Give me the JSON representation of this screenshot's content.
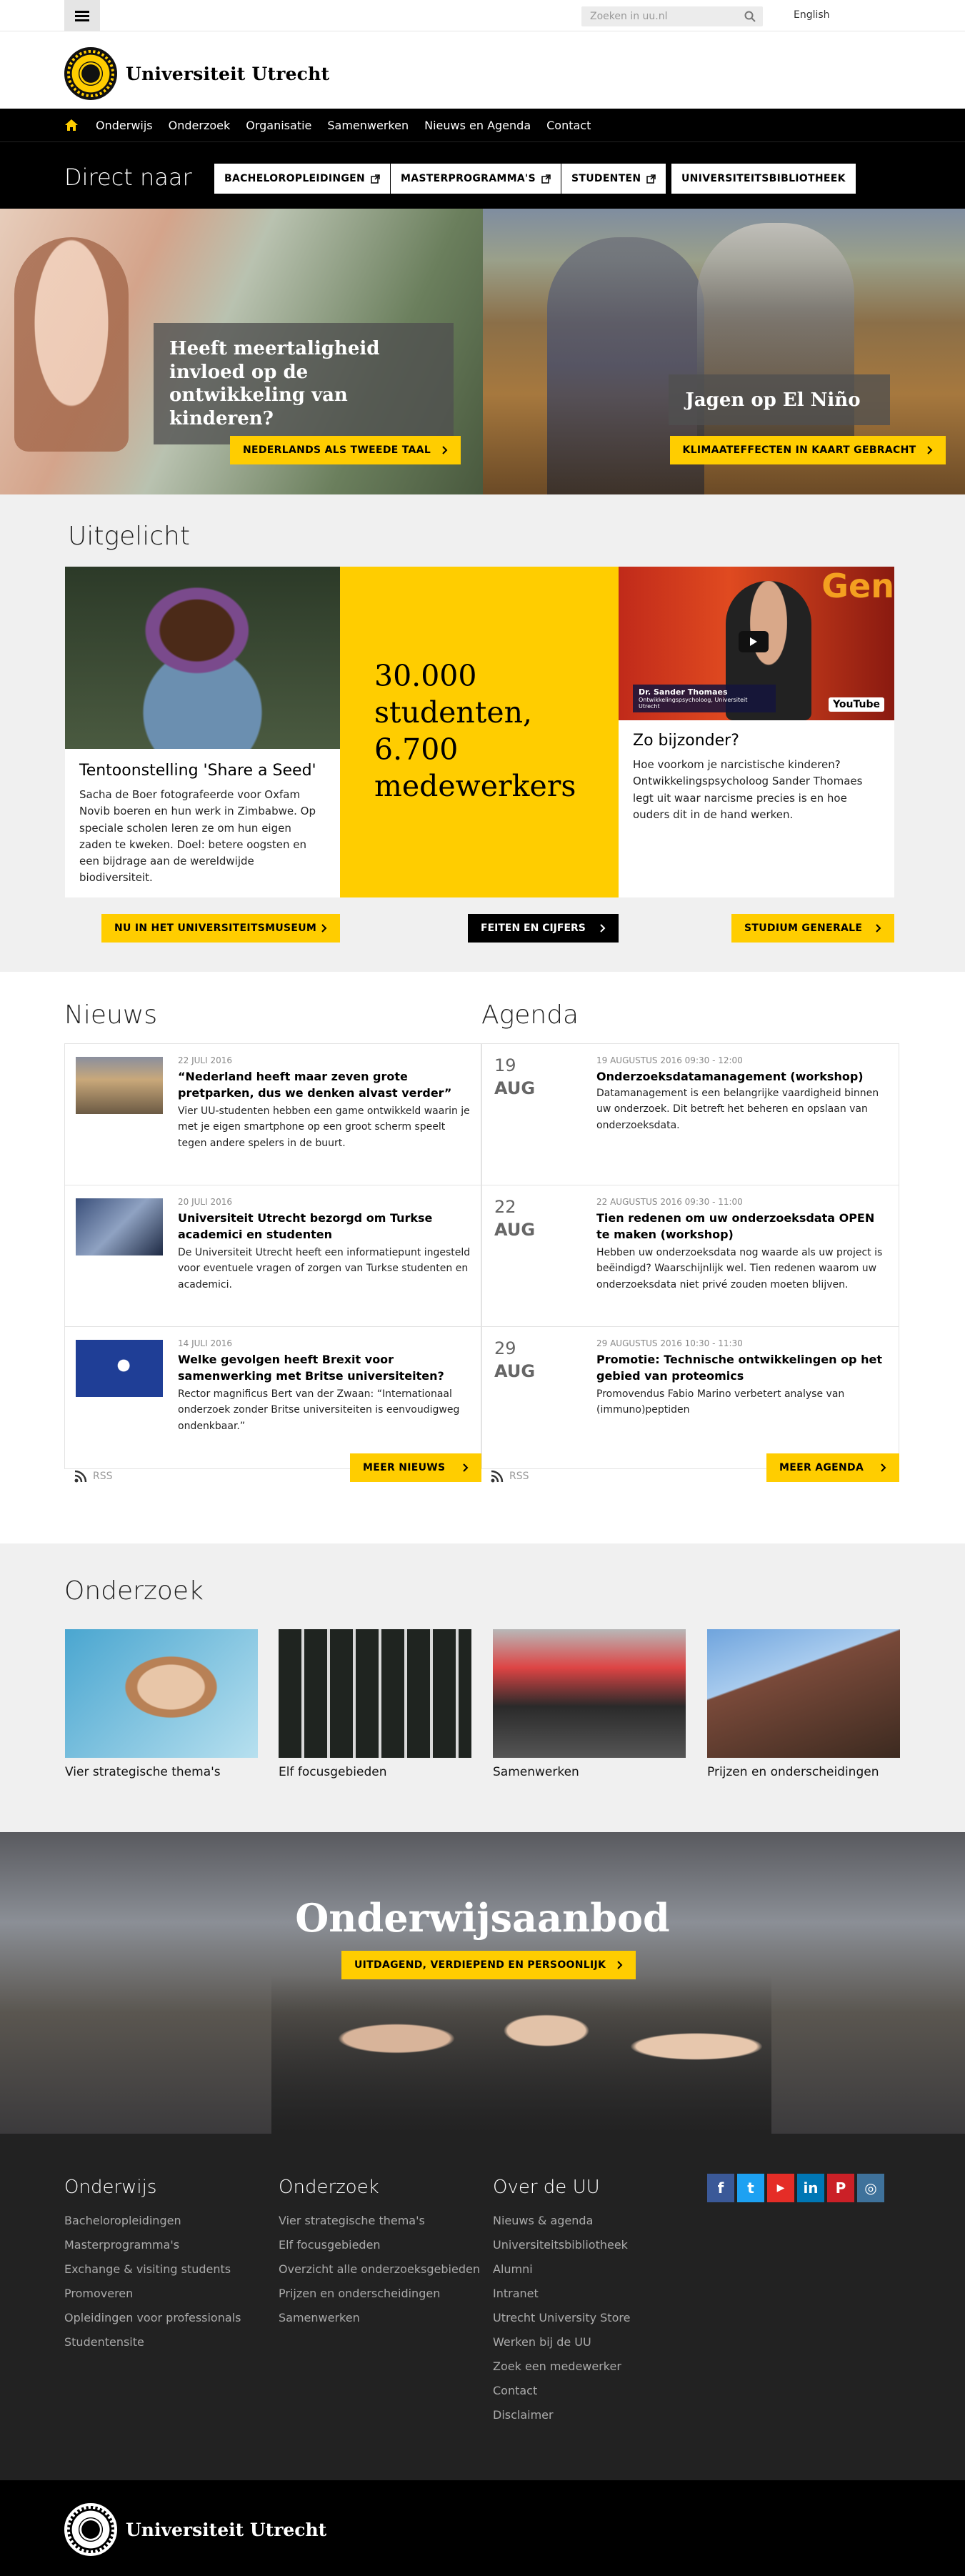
{
  "topbar": {
    "search_placeholder": "Zoeken in uu.nl",
    "lang": "English"
  },
  "logo": {
    "text": "Universiteit Utrecht"
  },
  "nav": {
    "items": [
      "Onderwijs",
      "Onderzoek",
      "Organisatie",
      "Samenwerken",
      "Nieuws en Agenda",
      "Contact"
    ]
  },
  "direct": {
    "title": "Direct naar",
    "buttons": [
      "BACHELOROPLEIDINGEN",
      "MASTERPROGRAMMA'S",
      "STUDENTEN",
      "UNIVERSITEITSBIBLIOTHEEK"
    ]
  },
  "hero": {
    "left": {
      "title": "Heeft meertaligheid invloed op de ontwikkeling van kinderen?",
      "button": "NEDERLANDS ALS TWEEDE TAAL"
    },
    "right": {
      "title": "Jagen op El Niño",
      "button": "KLIMAATEFFECTEN IN KAART GEBRACHT"
    }
  },
  "uitgelicht": {
    "title": "Uitgelicht",
    "card1": {
      "title": "Tentoonstelling 'Share a Seed'",
      "text": "Sacha de Boer fotografeerde voor Oxfam Novib boeren en hun werk in Zimbabwe. Op speciale scholen leren ze om hun eigen zaden te kweken. Doel: betere oogsten en een bijdrage aan de wereldwijde biodiversiteit.",
      "button": "NU IN HET UNIVERSITEITSMUSEUM"
    },
    "card2": {
      "text": "30.000 studenten, 6.700 medewerkers",
      "button": "FEITEN EN CIJFERS"
    },
    "card3": {
      "title": "Zo bijzonder?",
      "text": "Hoe voorkom je narcistische kinderen? Ontwikkelingspsycholoog Sander Thomaes legt uit waar narcisme precies is en hoe ouders dit in de hand werken.",
      "button": "STUDIUM GENERALE",
      "video_caption": "Dr. Sander Thomaes",
      "video_sub": "Ontwikkelingspsycholoog, Universiteit Utrecht",
      "video_brand": "YouTube",
      "video_bg": "Gen"
    }
  },
  "news": {
    "title": "Nieuws",
    "items": [
      {
        "date": "22 JULI 2016",
        "title": "“Nederland heeft maar zeven grote pretparken, dus we denken alvast verder”",
        "text": "Vier UU-studenten hebben een game ontwikkeld waarin je met je eigen smartphone op een groot scherm speelt tegen andere spelers in de buurt."
      },
      {
        "date": "20 JULI 2016",
        "title": "Universiteit Utrecht bezorgd om Turkse academici en studenten",
        "text": "De Universiteit Utrecht heeft een informatiepunt ingesteld voor eventuele vragen of zorgen van Turkse studenten en academici."
      },
      {
        "date": "14 JULI 2016",
        "title": "Welke gevolgen heeft Brexit voor samenwerking met Britse universiteiten?",
        "text": "Rector magnificus Bert van der Zwaan: “Internationaal onderzoek zonder Britse universiteiten is eenvoudigweg ondenkbaar.”"
      }
    ],
    "button": "MEER NIEUWS",
    "rss": "RSS"
  },
  "agenda": {
    "title": "Agenda",
    "items": [
      {
        "day": "19",
        "month": "AUG",
        "date": "19 AUGUSTUS 2016 09:30 - 12:00",
        "title": "Onderzoeksdatamanagement (workshop)",
        "text": "Datamanagement is een belangrijke vaardigheid binnen uw onderzoek. Dit betreft het beheren en opslaan van onderzoeksdata."
      },
      {
        "day": "22",
        "month": "AUG",
        "date": "22 AUGUSTUS 2016 09:30 - 11:00",
        "title": "Tien redenen om uw onderzoeksdata OPEN te maken (workshop)",
        "text": "Hebben uw onderzoeksdata nog waarde als uw project is beëindigd? Waarschijnlijk wel. Tien redenen waarom uw onderzoeksdata niet privé zouden moeten blijven."
      },
      {
        "day": "29",
        "month": "AUG",
        "date": "29 AUGUSTUS 2016 10:30 - 11:30",
        "title": "Promotie: Technische ontwikkelingen op het gebied van proteomics",
        "text": "Promovendus Fabio Marino verbetert analyse van (immuno)peptiden"
      }
    ],
    "button": "MEER AGENDA",
    "rss": "RSS"
  },
  "onderzoek": {
    "title": "Onderzoek",
    "tiles": [
      "Vier strategische thema's",
      "Elf focusgebieden",
      "Samenwerken",
      "Prijzen en onderscheidingen"
    ]
  },
  "aanbod": {
    "title": "Onderwijsaanbod",
    "button": "UITDAGEND, VERDIEPEND EN PERSOONLIJK"
  },
  "footer": {
    "col1": {
      "title": "Onderwijs",
      "links": [
        "Bacheloropleidingen",
        "Masterprogramma's",
        "Exchange & visiting students",
        "Promoveren",
        "Opleidingen voor professionals",
        "Studentensite"
      ]
    },
    "col2": {
      "title": "Onderzoek",
      "links": [
        "Vier strategische thema's",
        "Elf focusgebieden",
        "Overzicht alle onderzoeksgebieden",
        "Prijzen en onderscheidingen",
        "Samenwerken"
      ]
    },
    "col3": {
      "title": "Over de UU",
      "links": [
        "Nieuws & agenda",
        "Universiteitsbibliotheek",
        "Alumni",
        "Intranet",
        "Utrecht University Store",
        "Werken bij de UU",
        "Zoek een medewerker",
        "Contact",
        "Disclaimer"
      ]
    },
    "social": [
      "f",
      "t",
      "▶",
      "in",
      "P",
      "◎"
    ]
  },
  "bottom": {
    "logo_text": "Universiteit Utrecht"
  },
  "colors": {
    "yellow": "#ffcd00",
    "black": "#000000",
    "footer": "#222222"
  }
}
